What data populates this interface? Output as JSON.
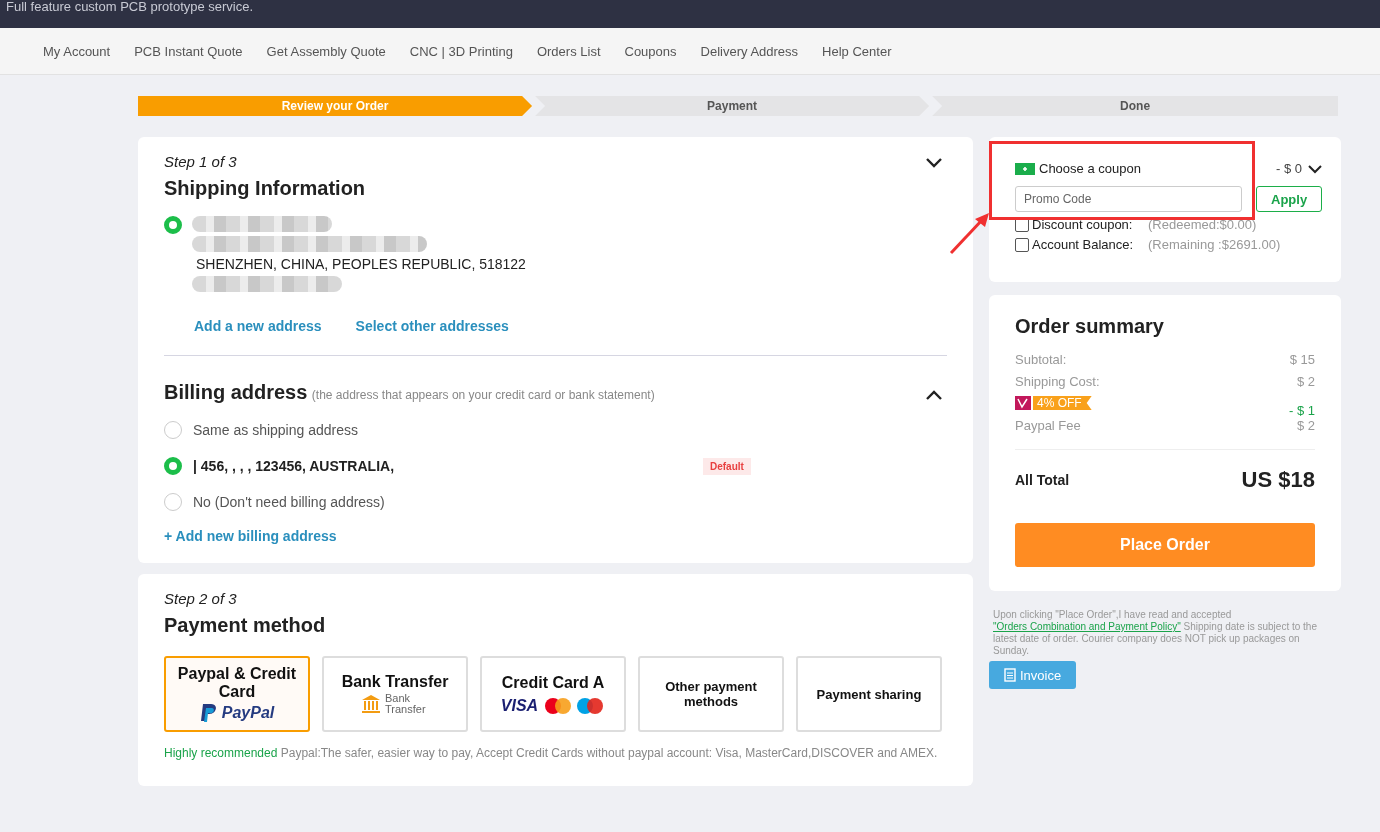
{
  "top_banner": {
    "text": "Full feature custom PCB prototype service."
  },
  "nav": [
    {
      "label": "My Account"
    },
    {
      "label": "PCB Instant Quote"
    },
    {
      "label": "Get Assembly Quote"
    },
    {
      "label": "CNC | 3D Printing"
    },
    {
      "label": "Orders List"
    },
    {
      "label": "Coupons"
    },
    {
      "label": "Delivery Address"
    },
    {
      "label": "Help Center"
    }
  ],
  "steps": [
    {
      "label": "Review your Order",
      "selected": true
    },
    {
      "label": "Payment",
      "selected": false
    },
    {
      "label": "Done",
      "selected": false
    }
  ],
  "shipping": {
    "step": "Step 1 of 3",
    "title": "Shipping Information",
    "expanded": false,
    "address": {
      "selected": true,
      "line": "SHENZHEN, CHINA, PEOPLES REPUBLIC, 518122"
    },
    "links": [
      "Add a new address",
      "Select other addresses"
    ]
  },
  "billing": {
    "title": "Billing address",
    "note": "(the address that appears on your credit card or bank statement)",
    "expanded": true,
    "options": [
      {
        "label": "Same as shipping address",
        "selected": false,
        "kind": "plain"
      },
      {
        "label": "| 456, , , , 123456, AUSTRALIA,",
        "selected": true,
        "kind": "address",
        "badge": "Default"
      },
      {
        "label": "No  (Don't need billing address)",
        "selected": false,
        "kind": "plain"
      }
    ],
    "add_link": "+ Add new billing address"
  },
  "payment": {
    "step": "Step 2 of 3",
    "title": "Payment method",
    "methods": [
      {
        "label": "Paypal & Credit Card",
        "selected": true,
        "kind": "paypal",
        "logo": "PayPal"
      },
      {
        "label": "Bank Transfer",
        "selected": false,
        "kind": "bank",
        "logo": "Bank Transfer"
      },
      {
        "label": "Credit Card A",
        "selected": false,
        "kind": "cards",
        "logo": "VISA"
      },
      {
        "label": "Other payment methods",
        "selected": false,
        "kind": "plain"
      },
      {
        "label": "Payment sharing",
        "selected": false,
        "kind": "plain"
      }
    ],
    "note_highlight": "Highly recommended",
    "note": "Paypal:The safer, easier way to pay, Accept Credit Cards without paypal account: Visa, MasterCard,DISCOVER and AMEX."
  },
  "coupon": {
    "label": "Choose a coupon",
    "amount": "- $ 0",
    "promo": {
      "placeholder": "Promo Code"
    },
    "apply": "Apply",
    "options": [
      {
        "label": "Discount coupon:",
        "checked": false,
        "info": "(Redeemed:$0.00)"
      },
      {
        "label": "Account Balance:",
        "checked": false,
        "info": "(Remaining :$2691.00)"
      }
    ]
  },
  "summary": {
    "title": "Order summary",
    "rows": [
      {
        "label": "Subtotal:",
        "value": "$ 15",
        "kind": "plain"
      },
      {
        "label": "Shipping Cost:",
        "value": "$ 2",
        "kind": "plain"
      },
      {
        "label": "4% OFF",
        "value": "- $ 1",
        "kind": "discount"
      },
      {
        "label": "Paypal Fee",
        "value": "$ 2",
        "kind": "plain"
      }
    ],
    "total_label": "All Total",
    "total": "US $18",
    "button": "Place Order"
  },
  "policy": {
    "before": "Upon clicking \"Place Order\",I have read and accepted ",
    "link": "\"Orders Combination and Payment Policy\"",
    "after": " Shipping date is subject to the latest date of order. Courier company does NOT pick up packages on Sunday."
  },
  "invoice": "Invoice"
}
